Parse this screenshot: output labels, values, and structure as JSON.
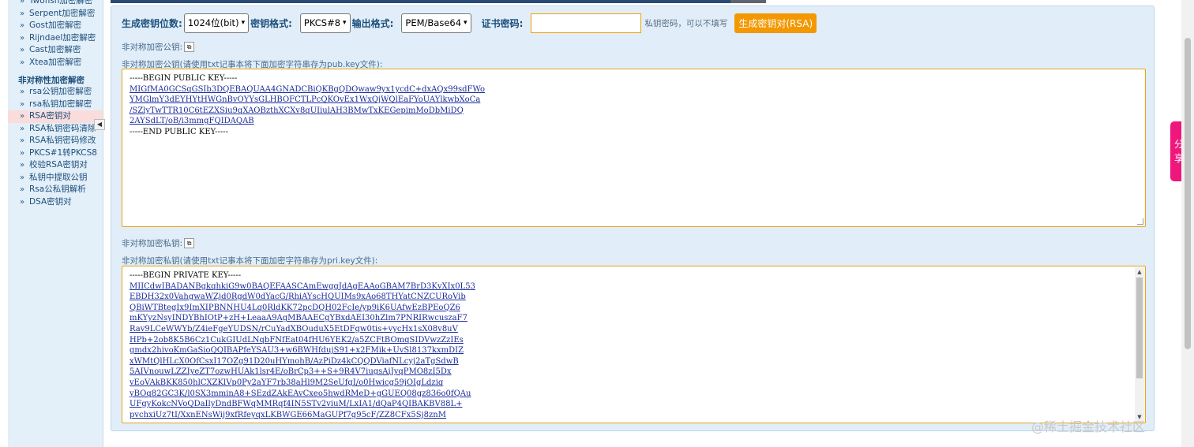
{
  "sidebar": {
    "items_top": [
      {
        "label": "Twofish加密解密"
      },
      {
        "label": "Serpent加密解密"
      },
      {
        "label": "Gost加密解密"
      },
      {
        "label": "Rijndael加密解密"
      },
      {
        "label": "Cast加密解密"
      },
      {
        "label": "Xtea加密解密"
      }
    ],
    "heading": "非对称性加密解密",
    "items": [
      {
        "label": "rsa公钥加密解密"
      },
      {
        "label": "rsa私钥加密解密"
      },
      {
        "label": "RSA密钥对"
      },
      {
        "label": "RSA私钥密码清除"
      },
      {
        "label": "RSA私钥密码修改"
      },
      {
        "label": "PKCS#1转PKCS8"
      },
      {
        "label": "校验RSA密钥对"
      },
      {
        "label": "私钥中提取公钥"
      },
      {
        "label": "Rsa公私钥解析"
      },
      {
        "label": "DSA密钥对"
      }
    ],
    "collapse_icon": "◀"
  },
  "options": {
    "bits_label": "生成密钥位数:",
    "bits_value": "1024位(bit)",
    "format_label": "密钥格式:",
    "format_value": "PKCS#8",
    "output_label": "输出格式:",
    "output_value": "PEM/Base64",
    "cert_pwd_label": "证书密码:",
    "cert_pwd_value": "",
    "cert_pwd_hint": "私钥密码，可以不填写",
    "generate_button": "生成密钥对(RSA)"
  },
  "public_key": {
    "title": "非对称加密公钥:",
    "desc": "非对称加密公钥(请使用txt记事本将下面加密字符串存为pub.key文件):",
    "begin": "-----BEGIN PUBLIC KEY-----",
    "lines": [
      "MIGfMA0GCSqGSIb3DQEBAQUAA4GNADCBiQKBgQDOwaw9yx1ycdC+dxAQx99sdFWo",
      "YMGlmY3dEYHYtHWGnBvOYYsGLHBOFCTLPcQKOvEx1WxQjWQlEaFYoUAYlkwbXoCa",
      "/SZlyTwTTR10C6tEZXSiu9qXAOBzthXCXv8qUIiulAH3BMwTxKEGepimMoDbMiDQ",
      "2AYSdLT/oB/i3mmgFQIDAQAB"
    ],
    "end": "-----END PUBLIC KEY-----"
  },
  "private_key": {
    "title": "非对称加密私钥:",
    "desc": "非对称加密私钥(请使用txt记事本将下面加密字符串存为pri.key文件):",
    "begin": "-----BEGIN PRIVATE KEY-----",
    "lines": [
      "MIICdwIBADANBgkqhkiG9w0BAQEFAASCAmEwggJdAgEAAoGBAM7BrD3KvXIx0L53",
      "EBDH32x0VahgwaWZjd0RgdW0dYacG/RhiAYscHQUIMs9xAo68THYatCNZCURoVib",
      "QBiWTBtegIx9ImXIPBNNHU4Lq0RldKK72pcDQH02FcIe/yp9iK6UAfwEzBPEoQZ6",
      "mKYyzNsyINDYBhIOtP+zH+LeaaA9AgMBAAECgYBxdAEI30hZlm7PNRIRwcuszaF7",
      "Rav9LCeWWYb/Z4ieFgeYUDSN/rCuYadXBOuduX5EtDFgw0tis+vycHx1sX08v8uV",
      "HPb+2ob8K5B6Cz1CukGIUdLNqbFNfEat04fHU6YEK2/a5ZCFtBOmqSIDVwzZzIEs",
      "gmdx2hivoKmGaSioQQIBAPfeYSAU3+w6BWHfdujS91+x2FMik+UvSl8137kxmDIZ",
      "xWMtQlHLcX0OfCsxI17OZg91D20uHYmohB/AzPiDz4kCQQDViafNLcyj2aTgSdwB",
      "5AIVnouwLZZIyeZT7ozwHUAk1lsr4E/oBrCp3++S+9R4V7iugsAiJyqPMO8zI5Dx",
      "vEoVAkBKK850hlCXZKlVp0Py2aYF7rb38aHl9M2SeUfgI/o0Hwicg59jOIgLdziq",
      "yBOq82GC3K/l0SX3mminA8+SEzdZAkEAvCxeo5hwdRMeD+gGUEQ08gz836o0fQAu",
      "UFgyKokcNVoQDaIlyDndBFWqMMRqf4IN5STv2viuM/LxIA1/dQaP4QIBAKBV88L+",
      "pvchxiUz7tI/XxnENsWij9xfRfeyqxLKBWGE66MaGUPf7g95cF/ZZ8CFx5Sj8znM"
    ]
  },
  "share_tab": {
    "label": "分享"
  },
  "watermark": "@稀土掘金技术社区"
}
